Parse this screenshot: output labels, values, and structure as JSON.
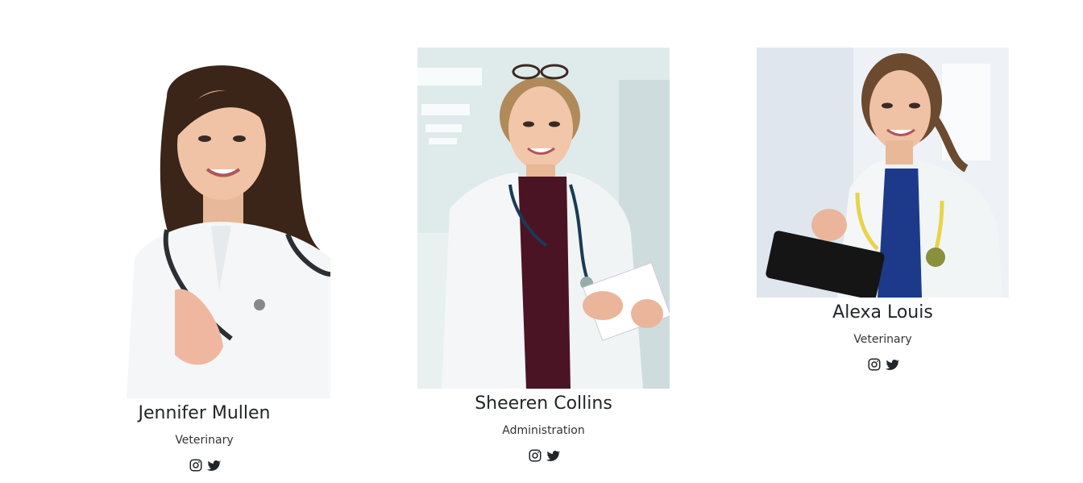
{
  "team": {
    "members": [
      {
        "name": "Jennifer Mullen",
        "role": "Veterinary",
        "photo_alt": "Jennifer Mullen"
      },
      {
        "name": "Sheeren Collins",
        "role": "Administration",
        "photo_alt": "Sheeren Collins"
      },
      {
        "name": "Alexa Louis",
        "role": "Veterinary",
        "photo_alt": "Alexa Louis"
      }
    ],
    "social_icons": [
      "instagram-icon",
      "twitter-icon"
    ]
  },
  "colors": {
    "text": "#212529",
    "coat": "#f4f6f7",
    "hair_dark": "#3b2418",
    "hair_light": "#b08a5a",
    "shirt_maroon": "#4a1424",
    "scrubs_blue": "#1d3a8a",
    "hallway": "#dfeaeb"
  }
}
